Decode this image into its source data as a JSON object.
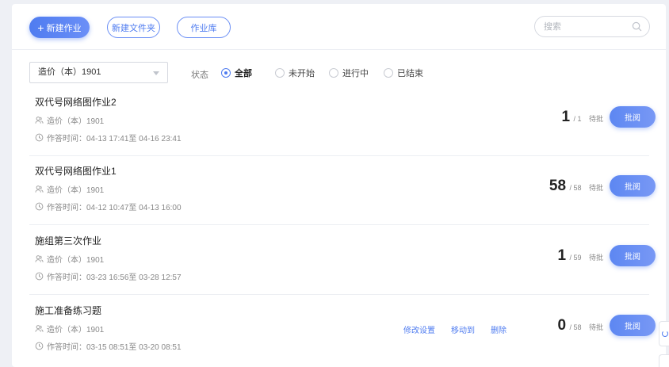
{
  "toolbar": {
    "new_assignment_label": "新建作业",
    "new_folder_label": "新建文件夹",
    "library_label": "作业库",
    "search_placeholder": "搜索"
  },
  "filters": {
    "class_selected": "造价（本）1901",
    "status_label": "状态",
    "statuses": [
      {
        "label": "全部",
        "checked": true
      },
      {
        "label": "未开始",
        "checked": false
      },
      {
        "label": "进行中",
        "checked": false
      },
      {
        "label": "已结束",
        "checked": false
      }
    ]
  },
  "assignments": [
    {
      "title": "双代号网络图作业2",
      "class": "造价（本）1901",
      "time": "作答时间：04-13 17:41至 04-16 23:41",
      "submitted": "1",
      "total": "/ 1",
      "pending": "待批",
      "grade_label": "批阅"
    },
    {
      "title": "双代号网络图作业1",
      "class": "造价（本）1901",
      "time": "作答时间：04-12 10:47至 04-13 16:00",
      "submitted": "58",
      "total": "/ 58",
      "pending": "待批",
      "grade_label": "批阅"
    },
    {
      "title": "施组第三次作业",
      "class": "造价（本）1901",
      "time": "作答时间：03-23 16:56至 03-28 12:57",
      "submitted": "1",
      "total": "/ 59",
      "pending": "待批",
      "grade_label": "批阅"
    },
    {
      "title": "施工准备练习题",
      "class": "造价（本）1901",
      "time": "作答时间：03-15 08:51至 03-20 08:51",
      "submitted": "0",
      "total": "/ 58",
      "pending": "待批",
      "grade_label": "批阅",
      "actions": {
        "edit": "修改设置",
        "move": "移动到",
        "delete": "删除"
      }
    }
  ],
  "colors": {
    "accent": "#4f7cf0",
    "text": "#222222",
    "muted": "#888888"
  }
}
